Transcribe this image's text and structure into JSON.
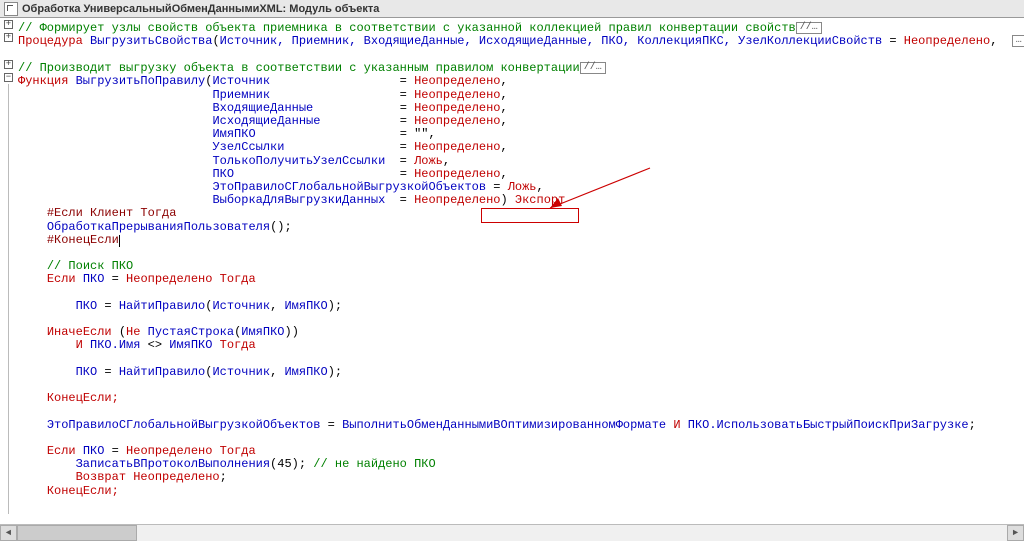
{
  "title": "Обработка УниверсальныйОбменДаннымиXML: Модуль объекта",
  "ellipsis": "//…",
  "box_ellipsis": "…",
  "code": {
    "l1_c": "// Формирует узлы свойств объекта приемника в соответствии с указанной коллекцией правил конвертации свойств",
    "l2_kw": "Процедура ",
    "l2_fn": "ВыгрузитьСвойства",
    "l2_p_open": "(",
    "l2_params": "Источник, Приемник, ВходящиеДанные, ИсходящиеДанные, ПКО, КоллекцияПКС, УзелКоллекцииСвойств",
    "l2_eq": " = ",
    "l2_val": "Неопределено",
    "l2_tail": ", ",
    "l3_c": "// Производит выгрузку объекта в соответствии с указанным правилом конвертации",
    "l4_kw": "Функция ",
    "l4_fn": "ВыгрузитьПоПравилу",
    "params": [
      {
        "name": "Источник",
        "val": "Неопределено"
      },
      {
        "name": "Приемник",
        "val": "Неопределено"
      },
      {
        "name": "ВходящиеДанные",
        "val": "Неопределено"
      },
      {
        "name": "ИсходящиеДанные",
        "val": "Неопределено"
      },
      {
        "name": "ИмяПКО",
        "val": "\"\""
      },
      {
        "name": "УзелСсылки",
        "val": "Неопределено"
      },
      {
        "name": "ТолькоПолучитьУзелСсылки",
        "val": "Ложь"
      },
      {
        "name": "ПКО",
        "val": "Неопределено"
      },
      {
        "name": "ЭтоПравилоСГлобальнойВыгрузкойОбъектов",
        "val": "Ложь"
      },
      {
        "name": "ВыборкаДляВыгрузкиДанных",
        "val": "Неопределено"
      }
    ],
    "export": "Экспорт",
    "pp_if": "#Если Клиент Тогда",
    "pp_call_fn": "ОбработкаПрерыванияПользователя",
    "pp_call_args": "();",
    "pp_endif": "#КонецЕсли",
    "c_poisk": "// Поиск ПКО",
    "if1": {
      "kw": "Если ",
      "var": "ПКО",
      "eq": " = ",
      "val": "Неопределено",
      "then": " Тогда"
    },
    "assign1": {
      "lhs": "ПКО",
      "eq": " = ",
      "fn": "НайтиПравило",
      "open": "(",
      "a1": "Источник",
      "comma": ", ",
      "a2": "ИмяПКО",
      "close": ");"
    },
    "elseif": {
      "kw": "ИначеЕсли ",
      "open": "(",
      "not": "Не ",
      "fn": "ПустаяСтрока",
      "open2": "(",
      "arg": "ИмяПКО",
      "close2": ")",
      ")": ")"
    },
    "elseif2": {
      "kw": "И ",
      "lhs": "ПКО.Имя",
      "neq": " <> ",
      "rhs": "ИмяПКО",
      "then": " Тогда"
    },
    "endif": "КонецЕсли;",
    "bigassign": {
      "lhs": "ЭтоПравилоСГлобальнойВыгрузкойОбъектов",
      "eq": " = ",
      "rhs1": "ВыполнитьОбменДаннымиВОптимизированномФормате",
      "and": " И ",
      "rhs2": "ПКО.ИспользоватьБыстрыйПоискПриЗагрузке",
      "semi": ";"
    },
    "if2": {
      "kw": "Если ",
      "var": "ПКО",
      "eq": " = ",
      "val": "Неопределено",
      "then": " Тогда"
    },
    "log": {
      "fn": "ЗаписатьВПротоколВыполнения",
      "open": "(",
      "num": "45",
      "close": "); ",
      "c": "// не найдено ПКО"
    },
    "ret": {
      "kw": "Возврат ",
      "val": "Неопределено",
      "semi": ";"
    }
  }
}
